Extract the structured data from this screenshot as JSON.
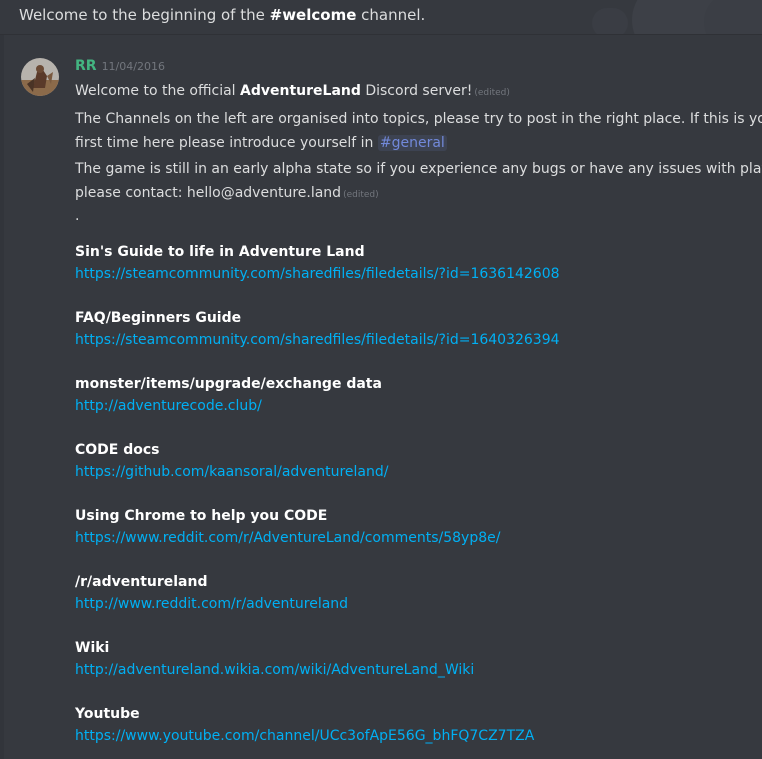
{
  "intro": {
    "prefix": "Welcome to the beginning of the ",
    "channel": "#welcome",
    "suffix": " channel."
  },
  "message": {
    "author": "RR",
    "timestamp": "11/04/2016",
    "edited_label": "(edited)",
    "line1_prefix": "Welcome to the official ",
    "line1_bold": "AdventureLand",
    "line1_suffix": " Discord server!",
    "line2": "The Channels on the left are organised into topics, please try to post in the right place. If this is your",
    "line3_prefix": "first time here please introduce yourself in ",
    "mention": "#general",
    "line4": "The game is still in an early alpha state so if you experience any bugs or have any issues with players",
    "line5": "please contact: hello@adventure.land",
    "dot": "."
  },
  "sections": [
    {
      "title": "Sin's Guide to life in Adventure Land",
      "link": "https://steamcommunity.com/sharedfiles/filedetails/?id=1636142608"
    },
    {
      "title": "FAQ/Beginners Guide",
      "link": "https://steamcommunity.com/sharedfiles/filedetails/?id=1640326394"
    },
    {
      "title": "monster/items/upgrade/exchange data",
      "link": "http://adventurecode.club/"
    },
    {
      "title": "CODE docs",
      "link": "https://github.com/kaansoral/adventureland/"
    },
    {
      "title": "Using Chrome to help you CODE",
      "link": "https://www.reddit.com/r/AdventureLand/comments/58yp8e/"
    },
    {
      "title": "/r/adventureland",
      "link": "http://www.reddit.com/r/adventureland"
    },
    {
      "title": "Wiki",
      "link": "http://adventureland.wikia.com/wiki/AdventureLand_Wiki"
    },
    {
      "title": "Youtube",
      "link": "https://www.youtube.com/channel/UCc3ofApE56G_bhFQ7CZ7TZA"
    }
  ],
  "colors": {
    "background": "#36393f",
    "author": "#43b581",
    "link": "#00b0f4",
    "mention": "#7289da"
  }
}
